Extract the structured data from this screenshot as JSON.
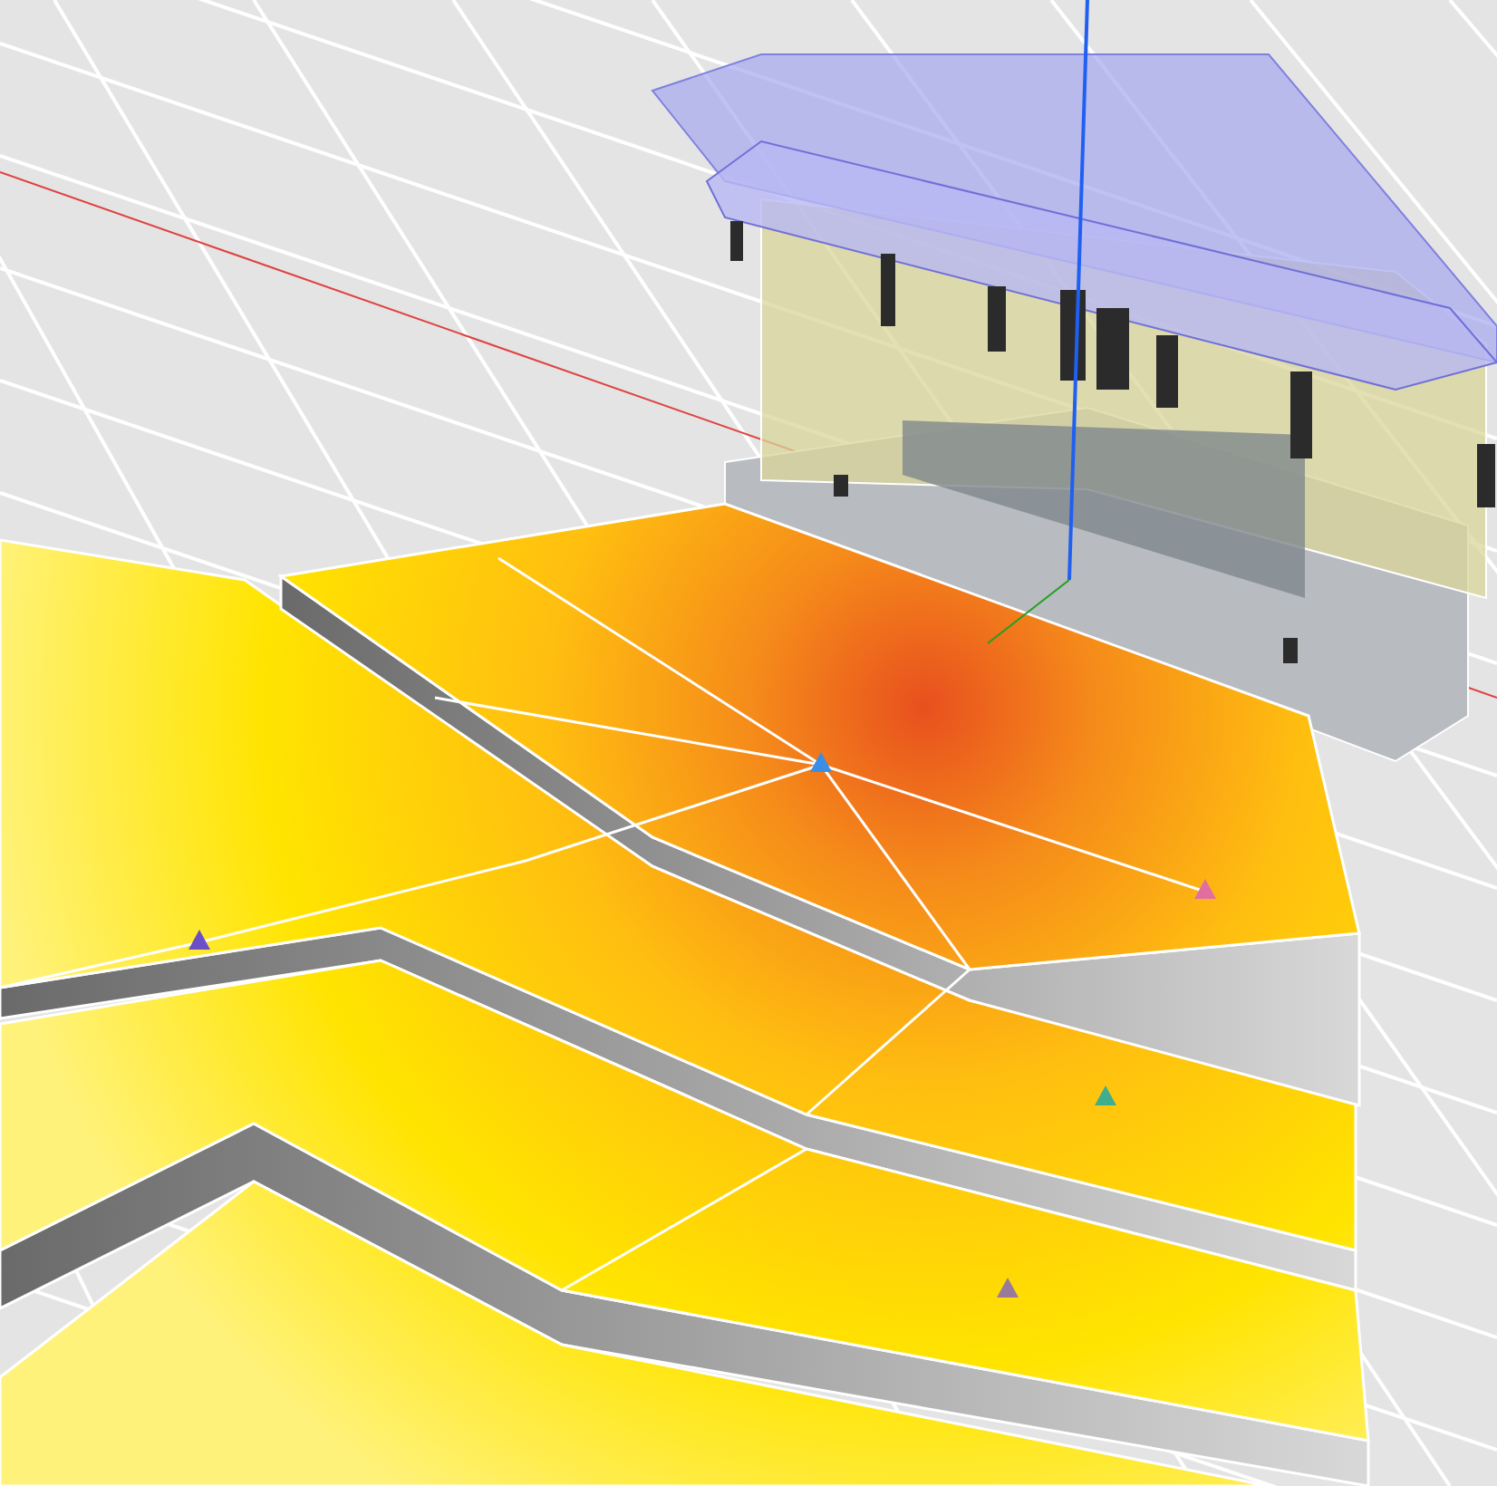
{
  "viewport": {
    "markers": [
      {
        "color": "#3a8ee6"
      },
      {
        "color": "#e06fa0"
      },
      {
        "color": "#6a4fc8"
      },
      {
        "color": "#3fae8c"
      },
      {
        "color": "#9a7a9a"
      }
    ]
  }
}
